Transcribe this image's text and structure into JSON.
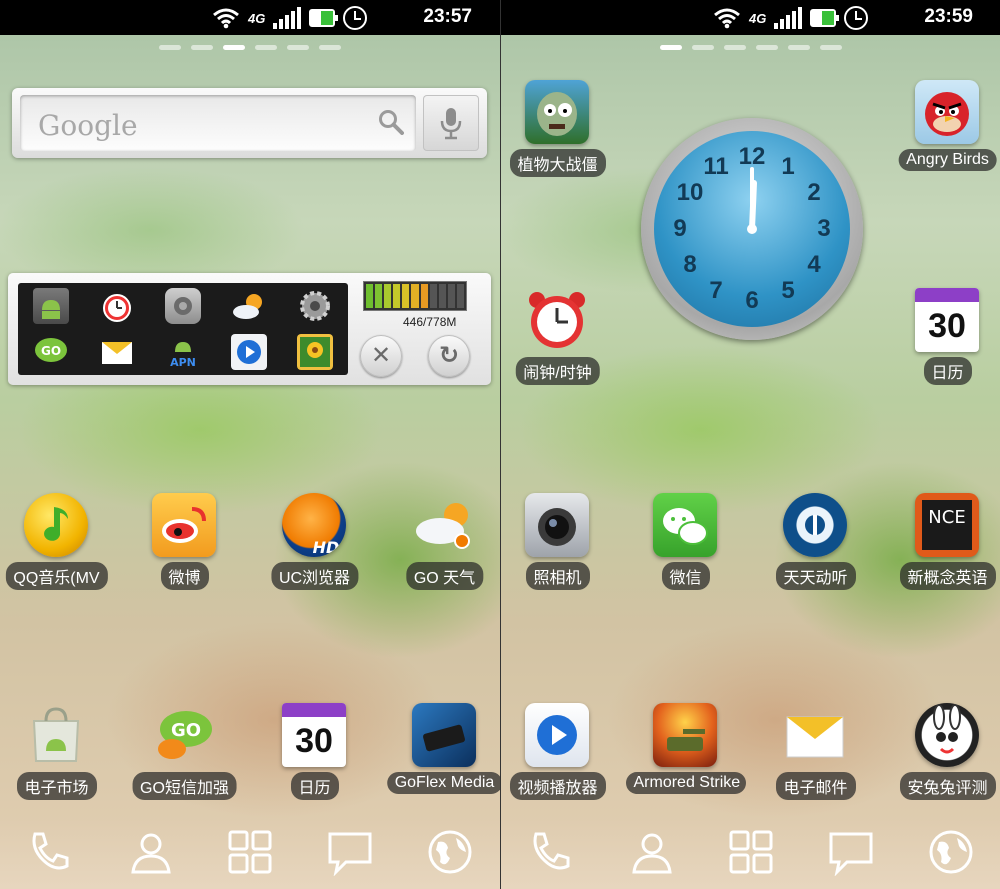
{
  "screens": [
    {
      "status": {
        "network": "4G",
        "time": "23:57"
      },
      "search": {
        "placeholder": "Google"
      },
      "toggle_widget": {
        "memory": "446/778M"
      },
      "row1": [
        {
          "label": "QQ音乐(MV",
          "icon": "qq-music-icon",
          "color": "#f6c400"
        },
        {
          "label": "微博",
          "icon": "weibo-icon",
          "color": "#f6b33a"
        },
        {
          "label": "UC浏览器",
          "icon": "uc-browser-icon",
          "color": "#1a4f9a"
        },
        {
          "label": "GO 天气",
          "icon": "go-weather-icon",
          "color": "#e6eef6"
        }
      ],
      "row2": [
        {
          "label": "电子市场",
          "icon": "android-market-icon",
          "color": "#d7dbcc"
        },
        {
          "label": "GO短信加强",
          "icon": "go-sms-icon",
          "color": "#6cc43b"
        },
        {
          "label": "日历",
          "icon": "calendar-icon",
          "color": "#ffffff",
          "day": "30"
        },
        {
          "label": "GoFlex Media",
          "icon": "goflex-icon",
          "color": "#1b5c96"
        }
      ]
    },
    {
      "status": {
        "network": "4G",
        "time": "23:59"
      },
      "top": [
        {
          "label": "植物大战僵",
          "icon": "plants-vs-zombies-icon",
          "color": "#5d8a47"
        },
        {
          "label": "Angry Birds",
          "icon": "angry-birds-icon",
          "color": "#d8232a"
        }
      ],
      "mid": [
        {
          "label": "闹钟/时钟",
          "icon": "alarm-clock-icon",
          "color": "#d82a2a"
        },
        {
          "label": "日历",
          "icon": "calendar-icon",
          "color": "#ffffff",
          "day": "30"
        }
      ],
      "clock": {
        "numbers": [
          "12",
          "1",
          "2",
          "3",
          "4",
          "5",
          "6",
          "7",
          "8",
          "9",
          "10",
          "11"
        ]
      },
      "row1": [
        {
          "label": "照相机",
          "icon": "camera-icon",
          "color": "#cfd2d6"
        },
        {
          "label": "微信",
          "icon": "wechat-icon",
          "color": "#4cbf3a"
        },
        {
          "label": "天天动听",
          "icon": "ttpod-icon",
          "color": "#0e4f8a"
        },
        {
          "label": "新概念英语",
          "icon": "nce-icon",
          "color": "#e05a1a"
        }
      ],
      "row2": [
        {
          "label": "视频播放器",
          "icon": "video-player-icon",
          "color": "#e9eef5"
        },
        {
          "label": "Armored Strike",
          "icon": "armored-strike-icon",
          "color": "#b43b1c"
        },
        {
          "label": "电子邮件",
          "icon": "email-icon",
          "color": "#f3c028"
        },
        {
          "label": "安兔兔评测",
          "icon": "antutu-icon",
          "color": "#222222"
        }
      ]
    }
  ],
  "dock": [
    "phone-icon",
    "contacts-icon",
    "app-drawer-icon",
    "messaging-icon",
    "browser-icon"
  ]
}
